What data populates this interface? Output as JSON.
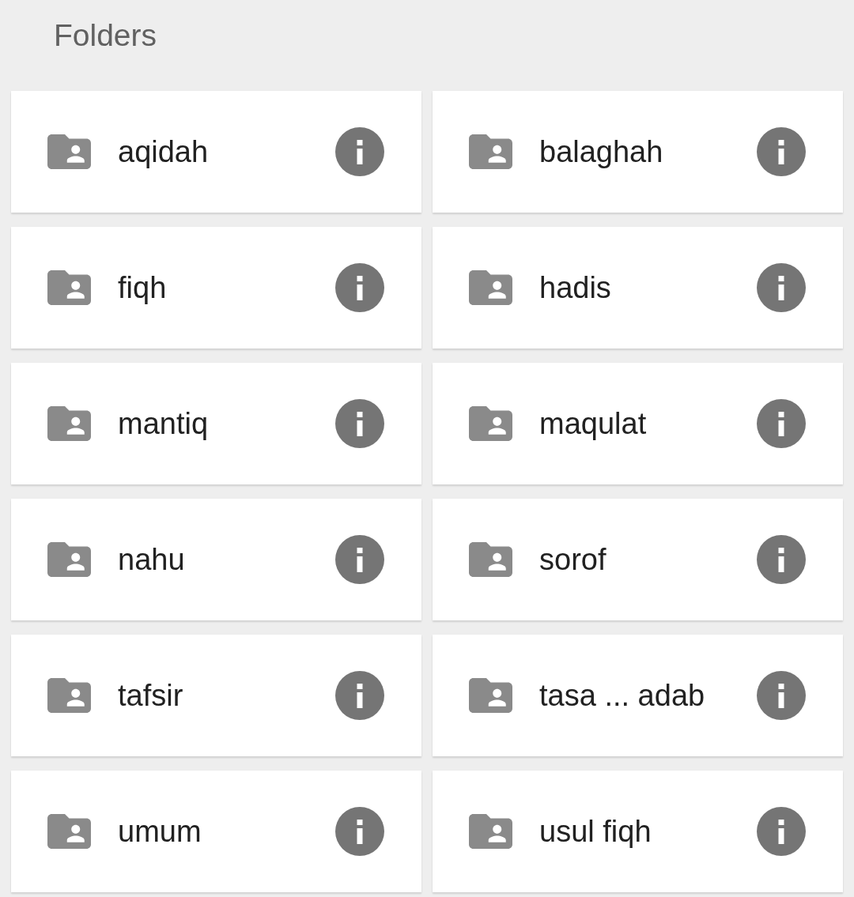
{
  "header": {
    "title": "Folders"
  },
  "folders": [
    {
      "name": "aqidah"
    },
    {
      "name": "balaghah"
    },
    {
      "name": "fiqh"
    },
    {
      "name": "hadis"
    },
    {
      "name": "mantiq"
    },
    {
      "name": "maqulat"
    },
    {
      "name": "nahu"
    },
    {
      "name": "sorof"
    },
    {
      "name": "tafsir"
    },
    {
      "name": "tasa ... adab"
    },
    {
      "name": "umum"
    },
    {
      "name": "usul fiqh"
    }
  ]
}
